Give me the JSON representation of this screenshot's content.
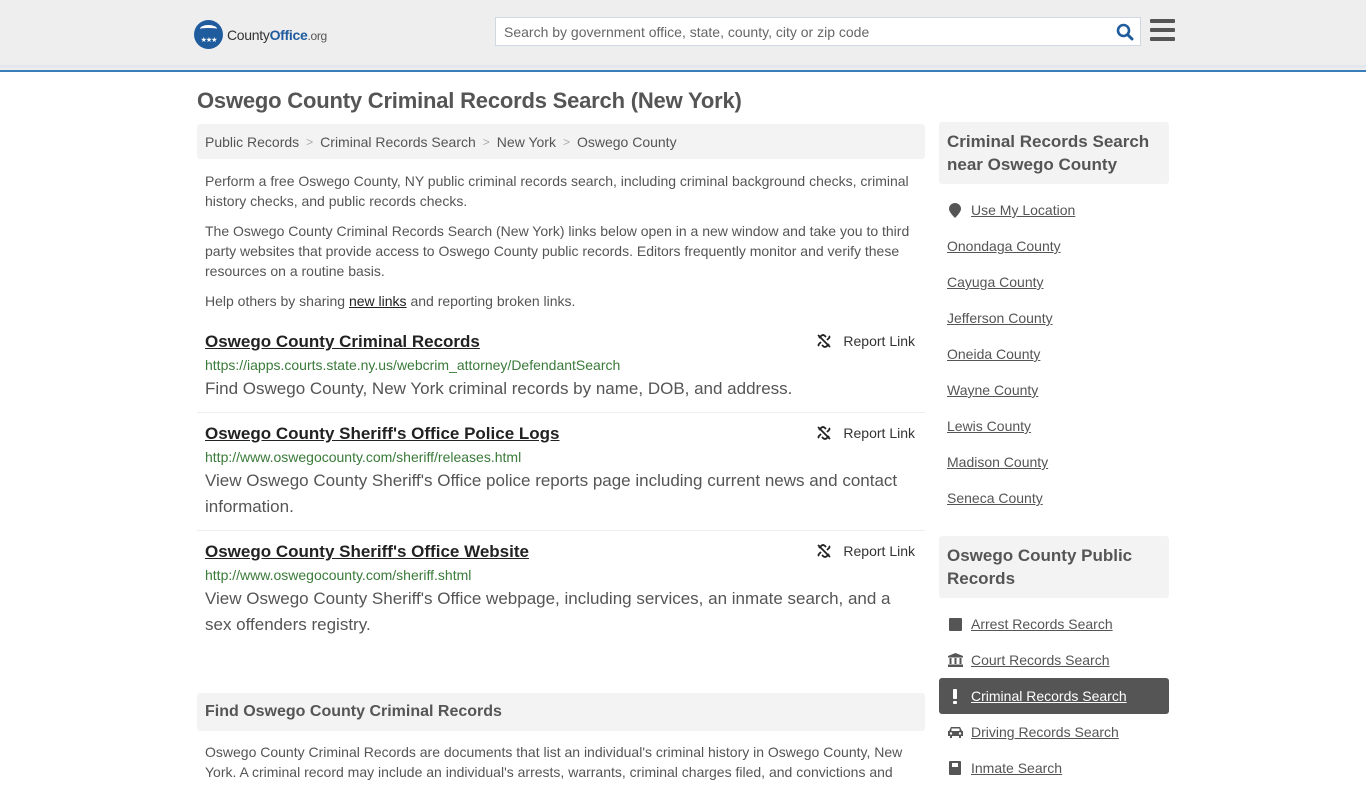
{
  "header": {
    "logo": {
      "county": "County",
      "office": "Office",
      "org": ".org"
    },
    "search": {
      "placeholder": "Search by government office, state, county, city or zip code",
      "value": ""
    }
  },
  "page": {
    "title": "Oswego County Criminal Records Search (New York)",
    "breadcrumb": [
      "Public Records",
      "Criminal Records Search",
      "New York",
      "Oswego County"
    ],
    "intro": {
      "p1": "Perform a free Oswego County, NY public criminal records search, including criminal background checks, criminal history checks, and public records checks.",
      "p2": "The Oswego County Criminal Records Search (New York) links below open in a new window and take you to third party websites that provide access to Oswego County public records. Editors frequently monitor and verify these resources on a routine basis.",
      "p3_before": "Help others by sharing ",
      "p3_link": "new links",
      "p3_after": " and reporting broken links."
    },
    "report_label": "Report Link",
    "links": [
      {
        "title": "Oswego County Criminal Records",
        "url": "https://iapps.courts.state.ny.us/webcrim_attorney/DefendantSearch",
        "desc": "Find Oswego County, New York criminal records by name, DOB, and address."
      },
      {
        "title": "Oswego County Sheriff's Office Police Logs",
        "url": "http://www.oswegocounty.com/sheriff/releases.html",
        "desc": "View Oswego County Sheriff's Office police reports page including current news and contact information."
      },
      {
        "title": "Oswego County Sheriff's Office Website",
        "url": "http://www.oswegocounty.com/sheriff.shtml",
        "desc": "View Oswego County Sheriff's Office webpage, including services, an inmate search, and a sex offenders registry."
      }
    ],
    "find": {
      "heading": "Find Oswego County Criminal Records",
      "body": "Oswego County Criminal Records are documents that list an individual's criminal history in Oswego County, New York. A criminal record may include an individual's arrests, warrants, criminal charges filed, and convictions and"
    }
  },
  "sidebar": {
    "nearby": {
      "heading": "Criminal Records Search near Oswego County",
      "use_location": "Use My Location",
      "counties": [
        "Onondaga County",
        "Cayuga County",
        "Jefferson County",
        "Oneida County",
        "Wayne County",
        "Lewis County",
        "Madison County",
        "Seneca County"
      ]
    },
    "public_records": {
      "heading": "Oswego County Public Records",
      "items": [
        {
          "label": "Arrest Records Search",
          "icon": "square-icon",
          "active": false
        },
        {
          "label": "Court Records Search",
          "icon": "courthouse-icon",
          "active": false
        },
        {
          "label": "Criminal Records Search",
          "icon": "exclamation-icon",
          "active": true
        },
        {
          "label": "Driving Records Search",
          "icon": "car-icon",
          "active": false
        },
        {
          "label": "Inmate Search",
          "icon": "inmate-icon",
          "active": false
        }
      ]
    }
  }
}
